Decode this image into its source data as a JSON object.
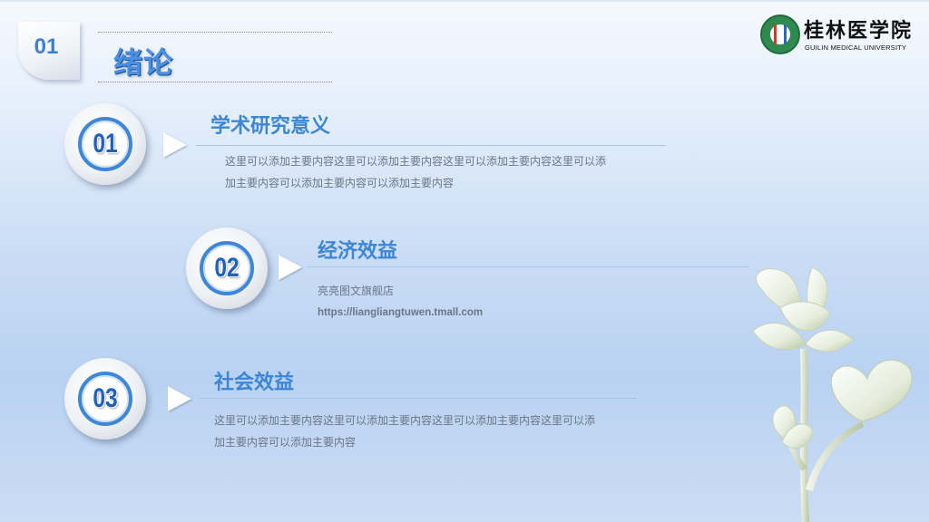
{
  "section": {
    "number": "01",
    "title": "绪论"
  },
  "logo": {
    "name_cn": "桂林医学院",
    "name_en": "GUILIN MEDICAL UNIVERSITY"
  },
  "items": [
    {
      "number": "01",
      "title": "学术研究意义",
      "lines": [
        "这里可以添加主要内容这里可以添加主要内容这里可以添加主要内容这里可以添",
        "加主要内容可以添加主要内容可以添加主要内容"
      ]
    },
    {
      "number": "02",
      "title": "经济效益",
      "lines": [
        "亮亮图文旗舰店"
      ],
      "url": "https://liangliangtuwen.tmall.com"
    },
    {
      "number": "03",
      "title": "社会效益",
      "lines": [
        "这里可以添加主要内容这里可以添加主要内容这里可以添加主要内容这里可以添",
        "加主要内容可以添加主要内容"
      ]
    }
  ],
  "colors": {
    "accent": "#3d86d4",
    "body_text": "#6b7687",
    "title_blue": "#4a90e2"
  }
}
